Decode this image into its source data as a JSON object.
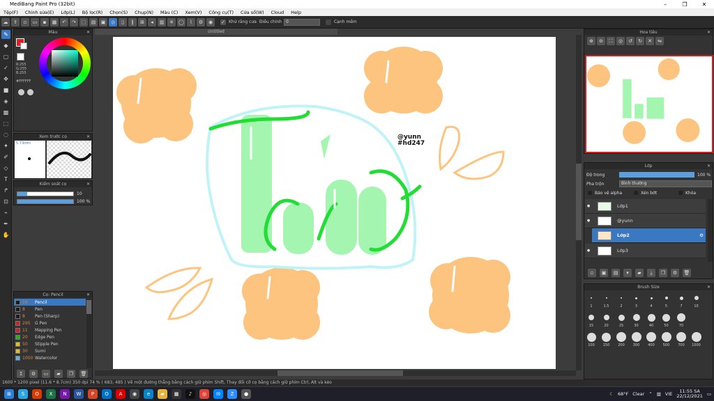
{
  "window": {
    "title": "MediBang Paint Pro (32bit)",
    "controls": [
      "–",
      "❐",
      "✕"
    ]
  },
  "menu": [
    "Tệp(F)",
    "Chỉnh sửa(E)",
    "Lớp(L)",
    "Bộ lọc(R)",
    "Chọn(S)",
    "Chụp(N)",
    "Màu (C)",
    "Xem(V)",
    "Công cụ(T)",
    "Cửa sổ(W)",
    "Cloud",
    "Help"
  ],
  "toolbar": {
    "antialias": "Khử răng cưa",
    "adjust_label": "Điều chỉnh",
    "adjust_value": "0",
    "snap": "Cạnh mềm"
  },
  "color_panel": {
    "title": "Màu",
    "r": "R:255",
    "g": "G:255",
    "b": "B:255",
    "hex": "#FFFFFF"
  },
  "preview_panel": {
    "title": "Xem trước cọ",
    "size": "5.73mm"
  },
  "brush_control": {
    "title": "Kiểm soát cọ",
    "size_value": "10",
    "opacity_value": "100 %"
  },
  "brush_list": {
    "title": "Cọ: Pencil",
    "items": [
      {
        "n": "10",
        "name": "Pencil",
        "color": "#1a1a1a",
        "active": true
      },
      {
        "n": "8",
        "name": "Pen",
        "color": "#1a1a1a"
      },
      {
        "n": "8",
        "name": "Pen (Sharp)",
        "color": "#1a1a1a"
      },
      {
        "n": "295",
        "name": "G Pen",
        "color": "#d02020"
      },
      {
        "n": "11",
        "name": "Mapping Pen",
        "color": "#d02020"
      },
      {
        "n": "20",
        "name": "Edge Pen",
        "color": "#20b020"
      },
      {
        "n": "50",
        "name": "Stipple Pen",
        "color": "#e0c020"
      },
      {
        "n": "30",
        "name": "Sumi",
        "color": "#e0c020"
      },
      {
        "n": "1000",
        "name": "Watercolor",
        "color": "#60b0e0"
      }
    ]
  },
  "doc_tab": "Untitled",
  "canvas": {
    "signature_line1": "@yunn",
    "signature_line2": "#hd247"
  },
  "navigator": {
    "title": "Hoa tiêu"
  },
  "layer_panel": {
    "title": "Lớp",
    "opacity_label": "Độ trong",
    "opacity_value": "100 %",
    "blend_label": "Pha trộn",
    "blend_value": "Bình thường",
    "protect_alpha": "Bảo vệ alpha",
    "clip": "Xén bớt",
    "lock": "Khóa",
    "layers": [
      {
        "name": "Lớp1"
      },
      {
        "name": "@yunn"
      },
      {
        "name": "Lớp2",
        "active": true
      },
      {
        "name": "Lớp3"
      }
    ]
  },
  "brush_size": {
    "title": "Brush Size",
    "row1": [
      "1",
      "1.5",
      "2",
      "3",
      "4",
      "5",
      "7",
      "10"
    ],
    "row2": [
      "15",
      "20",
      "25",
      "30",
      "40",
      "50",
      "70"
    ],
    "row3": [
      "100",
      "150",
      "200",
      "300",
      "400",
      "500",
      "700",
      "1000"
    ]
  },
  "status": "1600 * 1200 pixel   (11.6 * 8.7cm)   350 dpi   74 %   ( 683, 485 )   Vẽ một đường thẳng bằng cách giữ phím Shift, Thay đổi cỡ cọ bằng cách giữ phím Ctrl, Alt và kéo",
  "taskbar": {
    "weather_temp": "68°F",
    "weather": "Clear",
    "lang": "VIE",
    "time": "11:55 SA",
    "date": "22/12/2021"
  },
  "colors": {
    "accent": "#3a78c2",
    "peach": "#fcc47e",
    "green": "#a3f5b0",
    "bright_green": "#22dd33",
    "cyan": "#bff3f8"
  }
}
